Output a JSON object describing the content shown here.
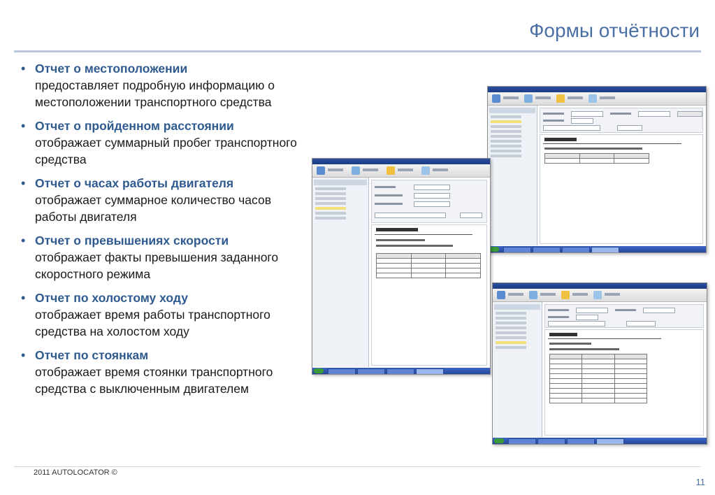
{
  "slide": {
    "title": "Формы отчётности",
    "footer": "2011 AUTOLOCATOR ©",
    "page_number": "11"
  },
  "bullets": [
    {
      "head": "Отчет о местоположении",
      "body": "предоставляет подробную информацию о местоположении транспортного средства"
    },
    {
      "head": "Отчет о пройденном расстоянии",
      "body": "отображает суммарный пробег транспортного средства"
    },
    {
      "head": "Отчет о часах работы двигателя",
      "body": "отображает суммарное количество часов работы двигателя"
    },
    {
      "head": "Отчет о превышениях  скорости",
      "body": "отображает факты превышения заданного скоростного режима"
    },
    {
      "head": "Отчет по холостому ходу",
      "body": "отображает время работы транспортного средства на холостом ходу"
    },
    {
      "head": "Отчет по стоянкам",
      "body": "отображает время стоянки транспортного средства с выключенным двигателем"
    }
  ],
  "bullet_symbol": "•",
  "colors": {
    "title": "#4a6fa5",
    "bullet_head": "#2e5a8f",
    "rule": "#b9c6d8"
  }
}
